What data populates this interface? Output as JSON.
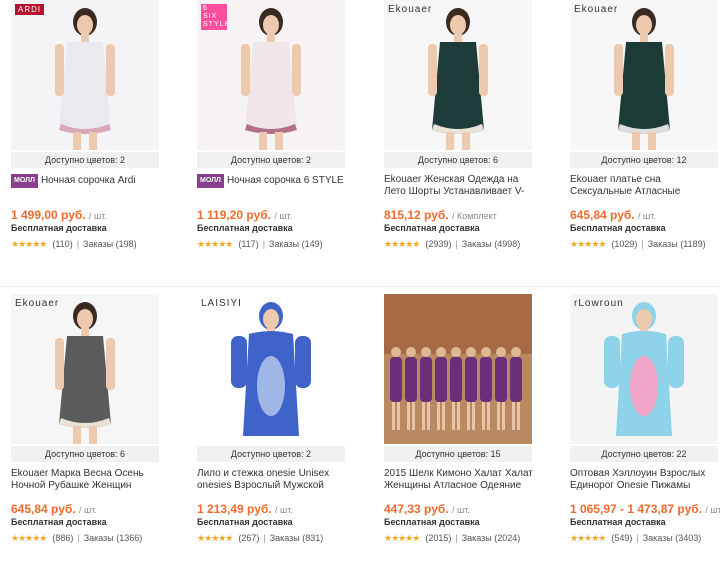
{
  "products": [
    {
      "brand": "ARDI",
      "colors": "Доступно цветов: 2",
      "mall": "МОЛЛ",
      "title": "Ночная сорочка Ardi",
      "price": "1 499,00 руб.",
      "unit": "/ шт.",
      "shipping": "Бесплатная доставка",
      "stars": "★★★★★",
      "reviews": "(110)",
      "orders": "Заказы (198)",
      "colors_hex": {
        "bg": "#f4f4f6",
        "garment": "#ece9ee",
        "trim": "#d8a7b8"
      }
    },
    {
      "brand": "6 SIX STYLE",
      "colors": "Доступно цветов: 2",
      "mall": "МОЛЛ",
      "title": "Ночная сорочка 6 STYLE",
      "price": "1 119,20 руб.",
      "unit": "/ шт.",
      "shipping": "Бесплатная доставка",
      "stars": "★★★★★",
      "reviews": "(117)",
      "orders": "Заказы (149)",
      "colors_hex": {
        "bg": "#f7f3f5",
        "garment": "#f0e6ea",
        "trim": "#b3708a"
      }
    },
    {
      "brand": "Ekouaer",
      "colors": "Доступно цветов: 6",
      "mall": "",
      "title": "Ekouaer Женская Одежда на Лето Шорты Устанавливает V-",
      "price": "815,12 руб.",
      "unit": "/ Комплект",
      "shipping": "Бесплатная доставка",
      "stars": "★★★★★",
      "reviews": "(2939)",
      "orders": "Заказы (4998)",
      "colors_hex": {
        "bg": "#f6f6f6",
        "garment": "#1e3d3a",
        "trim": "#e8e2d8"
      }
    },
    {
      "brand": "Ekouaer",
      "colors": "Доступно цветов: 12",
      "mall": "",
      "title": "Ekouaer платье сна Сексуальные Атласные Пижамы Шелковой",
      "price": "645,84 руб.",
      "unit": "/ шт.",
      "shipping": "Бесплатная доставка",
      "stars": "★★★★★",
      "reviews": "(1029)",
      "orders": "Заказы (1189)",
      "colors_hex": {
        "bg": "#f6f6f6",
        "garment": "#1c3b36",
        "trim": "#ddd"
      }
    },
    {
      "brand": "Ekouaer",
      "colors": "Доступно цветов: 6",
      "mall": "",
      "title": "Ekouaer Марка Весна Осень Ночной Рубашке Женщин",
      "price": "645,84 руб.",
      "unit": "/ шт.",
      "shipping": "Бесплатная доставка",
      "stars": "★★★★★",
      "reviews": "(886)",
      "orders": "Заказы (1366)",
      "colors_hex": {
        "bg": "#f6f6f6",
        "garment": "#5b5b5e",
        "trim": "#e9e3d6"
      }
    },
    {
      "brand": "LAISIYI",
      "colors": "Доступно цветов: 2",
      "mall": "",
      "title": "Лило и стежка onesie Unisex onesies Взрослый Мужской",
      "price": "1 213,49 руб.",
      "unit": "/ шт.",
      "shipping": "Бесплатная доставка",
      "stars": "★★★★★",
      "reviews": "(267)",
      "orders": "Заказы (831)",
      "colors_hex": {
        "bg": "#ffffff",
        "garment": "#3f63c9",
        "trim": "#9fb6e6"
      }
    },
    {
      "brand": "",
      "colors": "Доступно цветов: 15",
      "mall": "",
      "title": "2015 Шелк Кимоно Халат Халат Женщины Атласное Одеяние",
      "price": "447,33 руб.",
      "unit": "/ шт.",
      "shipping": "Бесплатная доставка",
      "stars": "★★★★★",
      "reviews": "(2015)",
      "orders": "Заказы (2024)",
      "colors_hex": {
        "bg": "#8b5a3c",
        "garment": "#6b2f7a",
        "trim": "#c9a0d6"
      }
    },
    {
      "brand": "rLowroun",
      "colors": "Доступно цветов: 22",
      "mall": "",
      "title": "Оптовая Хэллоуин Взрослых Единорог Onesie Пижамы",
      "price": "1 065,97 - 1 473,87 руб.",
      "unit": "/ шт.",
      "shipping": "Бесплатная доставка",
      "stars": "★★★★★",
      "reviews": "(549)",
      "orders": "Заказы (3403)",
      "colors_hex": {
        "bg": "#f4f4f4",
        "garment": "#8fd3ea",
        "trim": "#f2a6c7"
      }
    }
  ]
}
